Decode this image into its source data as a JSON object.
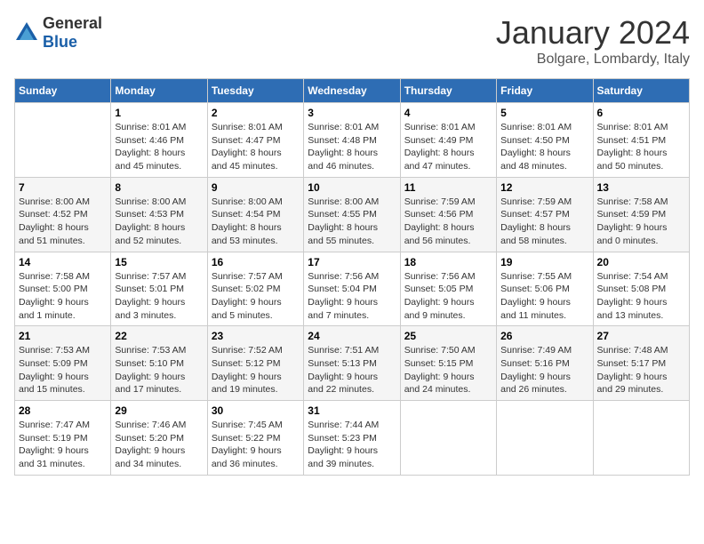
{
  "header": {
    "logo": {
      "text_general": "General",
      "text_blue": "Blue"
    },
    "title": "January 2024",
    "location": "Bolgare, Lombardy, Italy"
  },
  "weekdays": [
    "Sunday",
    "Monday",
    "Tuesday",
    "Wednesday",
    "Thursday",
    "Friday",
    "Saturday"
  ],
  "weeks": [
    [
      {
        "day": "",
        "info": ""
      },
      {
        "day": "1",
        "info": "Sunrise: 8:01 AM\nSunset: 4:46 PM\nDaylight: 8 hours\nand 45 minutes."
      },
      {
        "day": "2",
        "info": "Sunrise: 8:01 AM\nSunset: 4:47 PM\nDaylight: 8 hours\nand 45 minutes."
      },
      {
        "day": "3",
        "info": "Sunrise: 8:01 AM\nSunset: 4:48 PM\nDaylight: 8 hours\nand 46 minutes."
      },
      {
        "day": "4",
        "info": "Sunrise: 8:01 AM\nSunset: 4:49 PM\nDaylight: 8 hours\nand 47 minutes."
      },
      {
        "day": "5",
        "info": "Sunrise: 8:01 AM\nSunset: 4:50 PM\nDaylight: 8 hours\nand 48 minutes."
      },
      {
        "day": "6",
        "info": "Sunrise: 8:01 AM\nSunset: 4:51 PM\nDaylight: 8 hours\nand 50 minutes."
      }
    ],
    [
      {
        "day": "7",
        "info": "Sunrise: 8:00 AM\nSunset: 4:52 PM\nDaylight: 8 hours\nand 51 minutes."
      },
      {
        "day": "8",
        "info": "Sunrise: 8:00 AM\nSunset: 4:53 PM\nDaylight: 8 hours\nand 52 minutes."
      },
      {
        "day": "9",
        "info": "Sunrise: 8:00 AM\nSunset: 4:54 PM\nDaylight: 8 hours\nand 53 minutes."
      },
      {
        "day": "10",
        "info": "Sunrise: 8:00 AM\nSunset: 4:55 PM\nDaylight: 8 hours\nand 55 minutes."
      },
      {
        "day": "11",
        "info": "Sunrise: 7:59 AM\nSunset: 4:56 PM\nDaylight: 8 hours\nand 56 minutes."
      },
      {
        "day": "12",
        "info": "Sunrise: 7:59 AM\nSunset: 4:57 PM\nDaylight: 8 hours\nand 58 minutes."
      },
      {
        "day": "13",
        "info": "Sunrise: 7:58 AM\nSunset: 4:59 PM\nDaylight: 9 hours\nand 0 minutes."
      }
    ],
    [
      {
        "day": "14",
        "info": "Sunrise: 7:58 AM\nSunset: 5:00 PM\nDaylight: 9 hours\nand 1 minute."
      },
      {
        "day": "15",
        "info": "Sunrise: 7:57 AM\nSunset: 5:01 PM\nDaylight: 9 hours\nand 3 minutes."
      },
      {
        "day": "16",
        "info": "Sunrise: 7:57 AM\nSunset: 5:02 PM\nDaylight: 9 hours\nand 5 minutes."
      },
      {
        "day": "17",
        "info": "Sunrise: 7:56 AM\nSunset: 5:04 PM\nDaylight: 9 hours\nand 7 minutes."
      },
      {
        "day": "18",
        "info": "Sunrise: 7:56 AM\nSunset: 5:05 PM\nDaylight: 9 hours\nand 9 minutes."
      },
      {
        "day": "19",
        "info": "Sunrise: 7:55 AM\nSunset: 5:06 PM\nDaylight: 9 hours\nand 11 minutes."
      },
      {
        "day": "20",
        "info": "Sunrise: 7:54 AM\nSunset: 5:08 PM\nDaylight: 9 hours\nand 13 minutes."
      }
    ],
    [
      {
        "day": "21",
        "info": "Sunrise: 7:53 AM\nSunset: 5:09 PM\nDaylight: 9 hours\nand 15 minutes."
      },
      {
        "day": "22",
        "info": "Sunrise: 7:53 AM\nSunset: 5:10 PM\nDaylight: 9 hours\nand 17 minutes."
      },
      {
        "day": "23",
        "info": "Sunrise: 7:52 AM\nSunset: 5:12 PM\nDaylight: 9 hours\nand 19 minutes."
      },
      {
        "day": "24",
        "info": "Sunrise: 7:51 AM\nSunset: 5:13 PM\nDaylight: 9 hours\nand 22 minutes."
      },
      {
        "day": "25",
        "info": "Sunrise: 7:50 AM\nSunset: 5:15 PM\nDaylight: 9 hours\nand 24 minutes."
      },
      {
        "day": "26",
        "info": "Sunrise: 7:49 AM\nSunset: 5:16 PM\nDaylight: 9 hours\nand 26 minutes."
      },
      {
        "day": "27",
        "info": "Sunrise: 7:48 AM\nSunset: 5:17 PM\nDaylight: 9 hours\nand 29 minutes."
      }
    ],
    [
      {
        "day": "28",
        "info": "Sunrise: 7:47 AM\nSunset: 5:19 PM\nDaylight: 9 hours\nand 31 minutes."
      },
      {
        "day": "29",
        "info": "Sunrise: 7:46 AM\nSunset: 5:20 PM\nDaylight: 9 hours\nand 34 minutes."
      },
      {
        "day": "30",
        "info": "Sunrise: 7:45 AM\nSunset: 5:22 PM\nDaylight: 9 hours\nand 36 minutes."
      },
      {
        "day": "31",
        "info": "Sunrise: 7:44 AM\nSunset: 5:23 PM\nDaylight: 9 hours\nand 39 minutes."
      },
      {
        "day": "",
        "info": ""
      },
      {
        "day": "",
        "info": ""
      },
      {
        "day": "",
        "info": ""
      }
    ]
  ]
}
